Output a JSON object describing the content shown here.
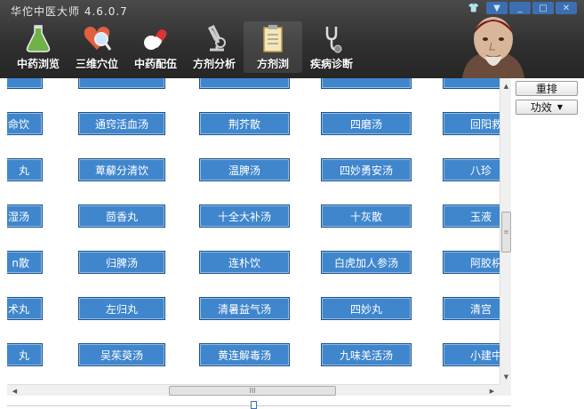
{
  "app": {
    "title": "华佗中医大师 4.6.0.7"
  },
  "window_controls": [
    {
      "name": "skin-icon",
      "glyph": "👕"
    },
    {
      "name": "menu-dropdown-icon",
      "glyph": "▼"
    },
    {
      "name": "minimize-icon",
      "glyph": "_"
    },
    {
      "name": "maximize-icon",
      "glyph": "□"
    },
    {
      "name": "close-icon",
      "glyph": "✕"
    }
  ],
  "toolbar": {
    "items": [
      {
        "label": "中药浏览",
        "icon": "flask-icon",
        "active": false
      },
      {
        "label": "三维穴位",
        "icon": "heart-magnifier-icon",
        "active": false
      },
      {
        "label": "中药配伍",
        "icon": "pills-icon",
        "active": false
      },
      {
        "label": "方剂分析",
        "icon": "microscope-icon",
        "active": false
      },
      {
        "label": "方剂浏",
        "icon": "clipboard-icon",
        "active": true
      },
      {
        "label": "疾病诊断",
        "icon": "stethoscope-icon",
        "active": false
      }
    ]
  },
  "grid": {
    "rows": [
      [
        "",
        "",
        "",
        "",
        ""
      ],
      [
        "命饮",
        "通窍活血汤",
        "荆芥散",
        "四磨汤",
        "回阳救"
      ],
      [
        "丸",
        "萆薢分清饮",
        "温脾汤",
        "四妙勇安汤",
        "八珍"
      ],
      [
        "湿汤",
        "茴香丸",
        "十全大补汤",
        "十灰散",
        "玉液"
      ],
      [
        "n散",
        "归脾汤",
        "连朴饮",
        "白虎加人参汤",
        "阿胶枳"
      ],
      [
        "术丸",
        "左归丸",
        "清暑益气汤",
        "四妙丸",
        "清宫"
      ],
      [
        "丸",
        "吴茱萸汤",
        "黄连解毒汤",
        "九味羌活汤",
        "小建中"
      ]
    ]
  },
  "side": {
    "reorder_label": "重排",
    "efficacy_label": "功效"
  },
  "scroll": {
    "h_thumb_label": "III",
    "v_thumb_label": "≡"
  },
  "colors": {
    "cell_bg": "#3f86cd",
    "cell_border": "#1f4f86",
    "topbar": "#333333"
  }
}
